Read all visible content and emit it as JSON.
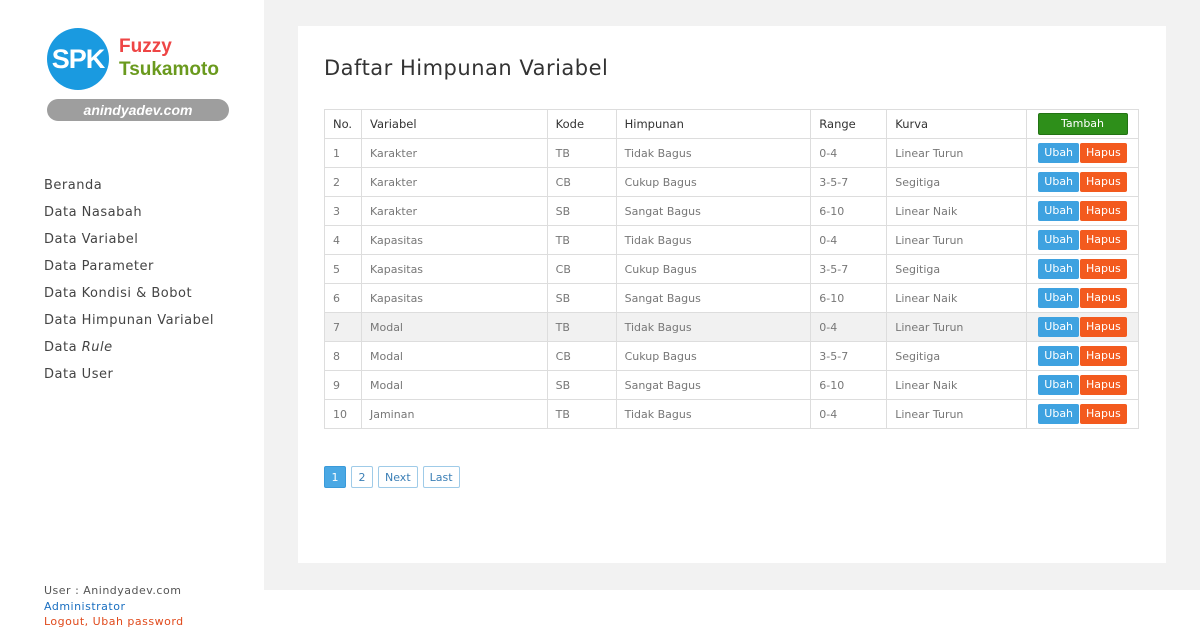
{
  "logo": {
    "badge": "SPK",
    "line1": "Fuzzy",
    "line2": "Tsukamoto",
    "site": "anindyadev.com"
  },
  "nav": [
    {
      "label": "Beranda"
    },
    {
      "label": "Data Nasabah"
    },
    {
      "label": "Data Variabel"
    },
    {
      "label": "Data Parameter"
    },
    {
      "label": "Data Kondisi & Bobot"
    },
    {
      "label": "Data Himpunan Variabel"
    },
    {
      "label_plain": "Data ",
      "label_italic": "Rule"
    },
    {
      "label": "Data User"
    }
  ],
  "user": {
    "line": "User : Anindyadev.com",
    "role": "Administrator",
    "logout": "Logout",
    "sep": ", ",
    "change_password": "Ubah password"
  },
  "main": {
    "title": "Daftar Himpunan Variabel",
    "headers": [
      "No.",
      "Variabel",
      "Kode",
      "Himpunan",
      "Range",
      "Kurva"
    ],
    "add_label": "Tambah",
    "edit_label": "Ubah",
    "delete_label": "Hapus",
    "rows": [
      {
        "no": "1",
        "variabel": "Karakter",
        "kode": "TB",
        "himpunan": "Tidak Bagus",
        "range": "0-4",
        "kurva": "Linear Turun"
      },
      {
        "no": "2",
        "variabel": "Karakter",
        "kode": "CB",
        "himpunan": "Cukup Bagus",
        "range": "3-5-7",
        "kurva": "Segitiga"
      },
      {
        "no": "3",
        "variabel": "Karakter",
        "kode": "SB",
        "himpunan": "Sangat Bagus",
        "range": "6-10",
        "kurva": "Linear Naik"
      },
      {
        "no": "4",
        "variabel": "Kapasitas",
        "kode": "TB",
        "himpunan": "Tidak Bagus",
        "range": "0-4",
        "kurva": "Linear Turun"
      },
      {
        "no": "5",
        "variabel": "Kapasitas",
        "kode": "CB",
        "himpunan": "Cukup Bagus",
        "range": "3-5-7",
        "kurva": "Segitiga"
      },
      {
        "no": "6",
        "variabel": "Kapasitas",
        "kode": "SB",
        "himpunan": "Sangat Bagus",
        "range": "6-10",
        "kurva": "Linear Naik"
      },
      {
        "no": "7",
        "variabel": "Modal",
        "kode": "TB",
        "himpunan": "Tidak Bagus",
        "range": "0-4",
        "kurva": "Linear Turun"
      },
      {
        "no": "8",
        "variabel": "Modal",
        "kode": "CB",
        "himpunan": "Cukup Bagus",
        "range": "3-5-7",
        "kurva": "Segitiga"
      },
      {
        "no": "9",
        "variabel": "Modal",
        "kode": "SB",
        "himpunan": "Sangat Bagus",
        "range": "6-10",
        "kurva": "Linear Naik"
      },
      {
        "no": "10",
        "variabel": "Jaminan",
        "kode": "TB",
        "himpunan": "Tidak Bagus",
        "range": "0-4",
        "kurva": "Linear Turun"
      }
    ],
    "highlighted_row": 7
  },
  "pagination": {
    "pages": [
      "1",
      "2"
    ],
    "current": "1",
    "next": "Next",
    "last": "Last"
  },
  "colors": {
    "edit": "#3ea2e0",
    "delete": "#f35a1e",
    "add": "#2e8f1a",
    "logo_blue": "#1a9ae0",
    "logo_red": "#ee4545",
    "logo_green": "#6a9a1e"
  }
}
